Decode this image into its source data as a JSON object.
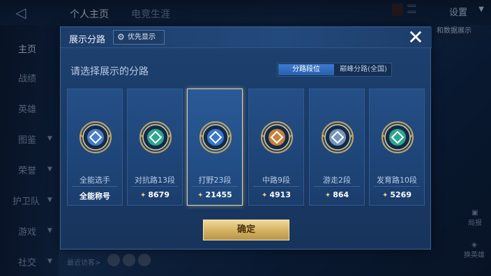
{
  "background": {
    "tabs": [
      "个人主页",
      "电竞生涯"
    ],
    "settings_label": "设置",
    "user_line1": "ssss",
    "user_line2": "ssss",
    "sidebar": [
      "主页",
      "战绩",
      "英雄",
      "图鉴",
      "荣誉",
      "护卫队",
      "游戏",
      "社交"
    ],
    "right_button": "和数据展示",
    "right_icons": [
      "局报",
      "换英雄"
    ],
    "bottom_visitors": "最近访客>"
  },
  "dialog": {
    "title": "展示分路",
    "priority_label": "优先显示",
    "close_icon": "close-icon",
    "prompt": "请选择展示的分路",
    "segment": {
      "active": "分路段位",
      "inactive": "巅峰分路(全国)"
    },
    "confirm_label": "确定"
  },
  "cards": [
    {
      "name": "全能选手",
      "badge": "全能称号",
      "emblem": "all-round-emblem",
      "color": "#4d86d6"
    },
    {
      "name": "对抗路13段",
      "score": "8679",
      "emblem": "clash-lane-emblem",
      "color": "#2fb596"
    },
    {
      "name": "打野23段",
      "score": "21455",
      "emblem": "jungle-emblem",
      "color": "#3a7fd9"
    },
    {
      "name": "中路9段",
      "score": "4913",
      "emblem": "mid-lane-emblem",
      "color": "#d98b3a"
    },
    {
      "name": "游走2段",
      "score": "864",
      "emblem": "roam-emblem",
      "color": "#7fa0c6"
    },
    {
      "name": "发育路10段",
      "score": "5269",
      "emblem": "farm-lane-emblem",
      "color": "#2fb596"
    }
  ],
  "accent": {
    "gold": "#e8d7a6",
    "selected_index": 2
  }
}
